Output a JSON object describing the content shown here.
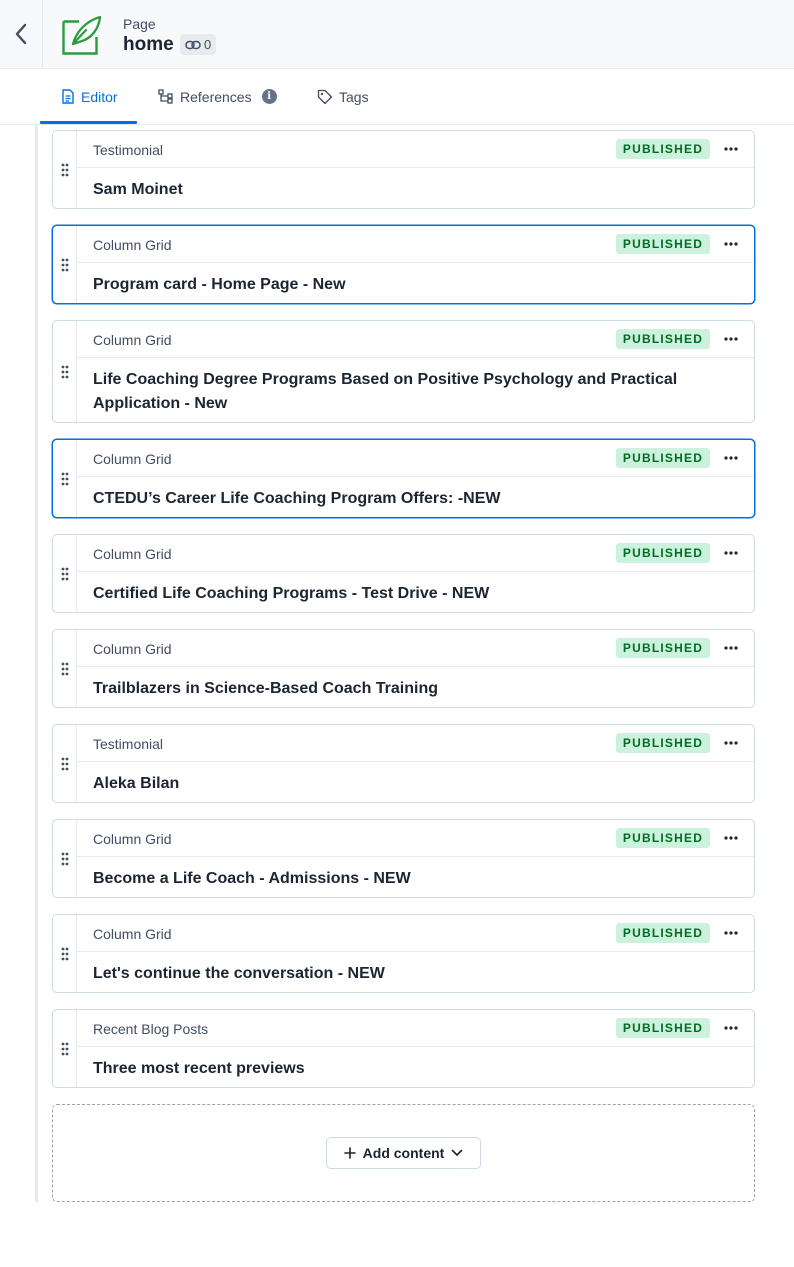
{
  "header": {
    "entry_type": "Page",
    "entry_name": "home",
    "link_count": "0",
    "accent_color": "#2a9c3f"
  },
  "tabs": [
    {
      "label": "Editor",
      "icon": "document-icon",
      "active": true
    },
    {
      "label": "References",
      "icon": "references-icon",
      "info_icon": "info-icon"
    },
    {
      "label": "Tags",
      "icon": "tag-icon"
    }
  ],
  "cards": [
    {
      "type": "Testimonial",
      "status": "PUBLISHED",
      "title": "Sam Moinet"
    },
    {
      "type": "Column Grid",
      "status": "PUBLISHED",
      "title": "Program card - Home Page - New"
    },
    {
      "type": "Column Grid",
      "status": "PUBLISHED",
      "title": "Life Coaching Degree Programs Based on Positive Psychology and Practical Application - New"
    },
    {
      "type": "Column Grid",
      "status": "PUBLISHED",
      "title": "CTEDU’s Career Life Coaching Program Offers: -NEW"
    },
    {
      "type": "Column Grid",
      "status": "PUBLISHED",
      "title": "Certified Life Coaching Programs - Test Drive - NEW"
    },
    {
      "type": "Column Grid",
      "status": "PUBLISHED",
      "title": "Trailblazers in Science-Based Coach Training"
    },
    {
      "type": "Testimonial",
      "status": "PUBLISHED",
      "title": "Aleka Bilan"
    },
    {
      "type": "Column Grid",
      "status": "PUBLISHED",
      "title": "Become a Life Coach - Admissions - NEW"
    },
    {
      "type": "Column Grid",
      "status": "PUBLISHED",
      "title": "Let's continue the conversation - NEW"
    },
    {
      "type": "Recent Blog Posts",
      "status": "PUBLISHED",
      "title": "Three most recent previews"
    }
  ],
  "add_content": {
    "label": "Add content"
  },
  "colors": {
    "primary": "#036fe3",
    "published_bg": "#ccf1dc",
    "published_text": "#006d23"
  }
}
